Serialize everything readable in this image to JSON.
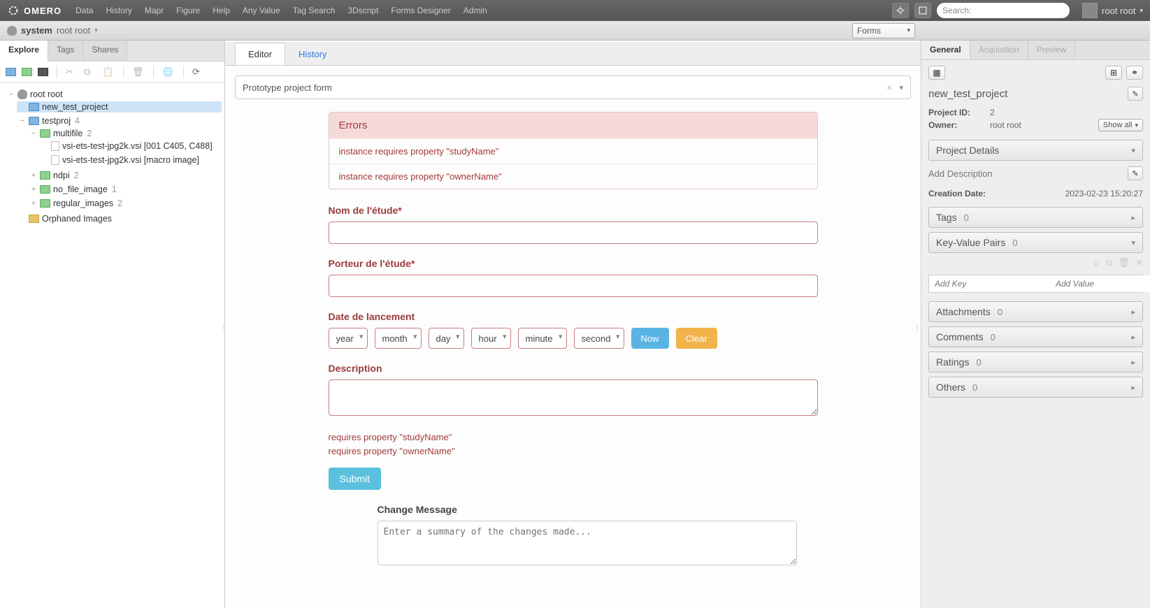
{
  "navbar": {
    "brand": "OMERO",
    "items": [
      "Data",
      "History",
      "Mapr",
      "Figure",
      "Help",
      "Any Value",
      "Tag Search",
      "3Dscript",
      "Forms Designer",
      "Admin"
    ],
    "search_label": "Search:",
    "user": "root root"
  },
  "subheader": {
    "group": "system",
    "user": "root root",
    "forms_label": "Forms"
  },
  "left": {
    "tabs": {
      "explore": "Explore",
      "tags": "Tags",
      "shares": "Shares"
    },
    "tree": {
      "root_user": "root root",
      "new_project": "new_test_project",
      "testproj": {
        "name": "testproj",
        "count": "4"
      },
      "multifile": {
        "name": "multifile",
        "count": "2"
      },
      "file1": "vsi-ets-test-jpg2k.vsi [001 C405, C488]",
      "file2": "vsi-ets-test-jpg2k.vsi [macro image]",
      "ndpi": {
        "name": "ndpi",
        "count": "2"
      },
      "no_file_image": {
        "name": "no_file_image",
        "count": "1"
      },
      "regular_images": {
        "name": "regular_images",
        "count": "2"
      },
      "orphaned": "Orphaned Images"
    }
  },
  "center": {
    "tabs": {
      "editor": "Editor",
      "history": "History"
    },
    "form_select": "Prototype project form",
    "errors": {
      "title": "Errors",
      "items": [
        "instance requires property \"studyName\"",
        "instance requires property \"ownerName\""
      ]
    },
    "fields": {
      "study_label": "Nom de l'étude*",
      "owner_label": "Porteur de l'étude*",
      "date_label": "Date de lancement",
      "desc_label": "Description",
      "date_options": {
        "year": "year",
        "month": "month",
        "day": "day",
        "hour": "hour",
        "minute": "minute",
        "second": "second"
      },
      "now": "Now",
      "clear": "Clear"
    },
    "req_lines": [
      "requires property \"studyName\"",
      "requires property \"ownerName\""
    ],
    "submit": "Submit",
    "change_msg_label": "Change Message",
    "change_msg_placeholder": "Enter a summary of the changes made..."
  },
  "right": {
    "tabs": {
      "general": "General",
      "acquisition": "Acquisition",
      "preview": "Preview"
    },
    "title": "new_test_project",
    "project_id_label": "Project ID:",
    "project_id": "2",
    "owner_label": "Owner:",
    "owner": "root root",
    "show_all": "Show all",
    "project_details": "Project Details",
    "add_description": "Add Description",
    "creation_label": "Creation Date:",
    "creation_value": "2023-02-23 15:20:27",
    "acc": {
      "tags": "Tags",
      "tags_n": "0",
      "kv": "Key-Value Pairs",
      "kv_n": "0",
      "att": "Attachments",
      "att_n": "0",
      "com": "Comments",
      "com_n": "0",
      "rat": "Ratings",
      "rat_n": "0",
      "oth": "Others",
      "oth_n": "0"
    },
    "kv_key_ph": "Add Key",
    "kv_val_ph": "Add Value"
  }
}
